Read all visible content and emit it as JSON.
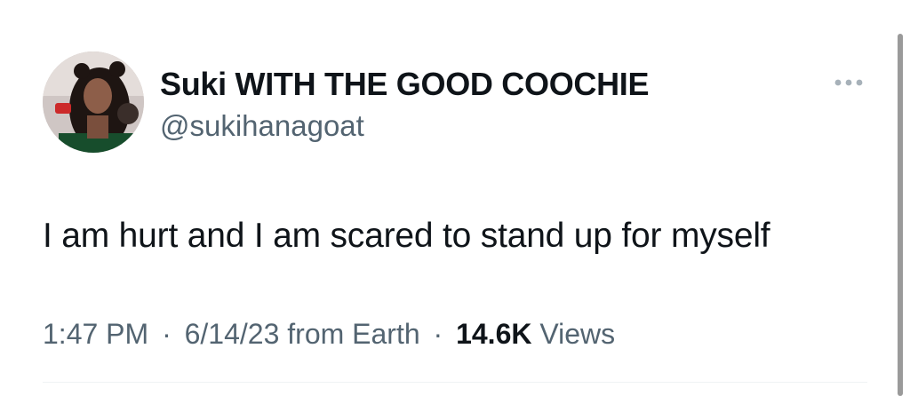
{
  "author": {
    "display_name": "Suki WITH THE GOOD COOCHIE",
    "handle": "@sukihanagoat",
    "avatar_icon": "profile-photo"
  },
  "more_icon": "more-horizontal-icon",
  "tweet": {
    "text": "I am hurt and I am scared to stand up for myself"
  },
  "meta": {
    "time": "1:47 PM",
    "separator": "·",
    "date": "6/14/23",
    "source": "from Earth",
    "views_count": "14.6K",
    "views_label": "Views"
  },
  "colors": {
    "primary_text": "#0f1419",
    "secondary_text": "#536471",
    "divider": "#eff3f4"
  }
}
